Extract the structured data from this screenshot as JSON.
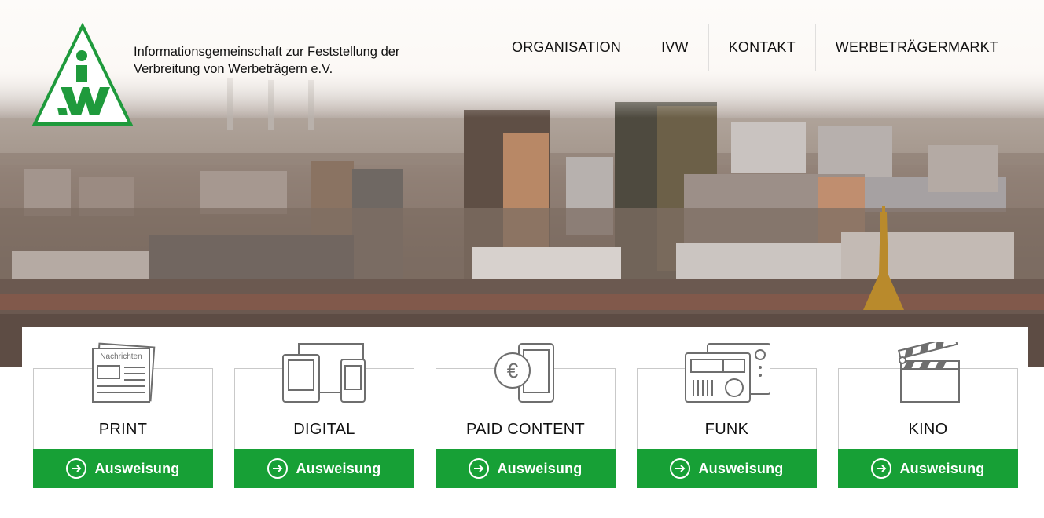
{
  "header": {
    "logo_text": "iVW",
    "tagline_line1": "Informationsgemeinschaft zur Feststellung der",
    "tagline_line2": "Verbreitung von Werbeträgern e.V."
  },
  "nav": {
    "items": [
      {
        "label": "ORGANISATION"
      },
      {
        "label": "IVW"
      },
      {
        "label": "KONTAKT"
      },
      {
        "label": "WERBETRÄGERMARKT"
      }
    ]
  },
  "cards": [
    {
      "title": "PRINT",
      "button": "Ausweisung",
      "icon": "newspaper-icon",
      "icon_text": "Nachrichten"
    },
    {
      "title": "DIGITAL",
      "button": "Ausweisung",
      "icon": "devices-icon"
    },
    {
      "title": "PAID CONTENT",
      "button": "Ausweisung",
      "icon": "euro-phone-icon",
      "icon_text": "€"
    },
    {
      "title": "FUNK",
      "button": "Ausweisung",
      "icon": "radio-icon"
    },
    {
      "title": "KINO",
      "button": "Ausweisung",
      "icon": "clapperboard-icon"
    }
  ],
  "colors": {
    "brand_green": "#17a036",
    "logo_green": "#1f9a3c",
    "text": "#111111",
    "icon_stroke": "#6e6e6e"
  }
}
